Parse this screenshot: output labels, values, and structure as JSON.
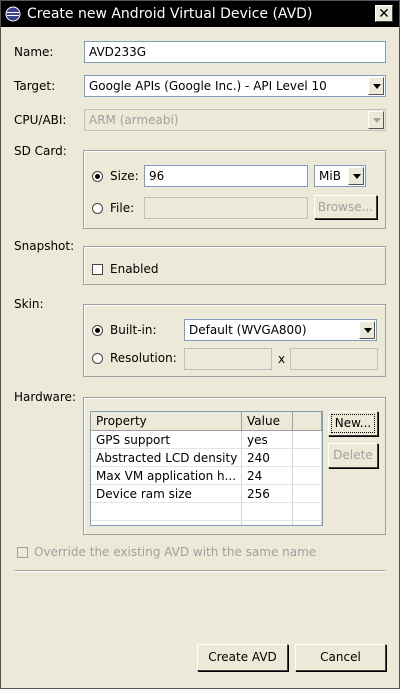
{
  "window": {
    "title": "Create new Android Virtual Device (AVD)",
    "close_glyph": "✕"
  },
  "name": {
    "label": "Name:",
    "value": "AVD233G"
  },
  "target": {
    "label": "Target:",
    "value": "Google APIs (Google Inc.) - API Level 10"
  },
  "cpu": {
    "label": "CPU/ABI:",
    "value": "ARM (armeabi)"
  },
  "sdcard": {
    "label": "SD Card:",
    "size_label": "Size:",
    "size_value": "96",
    "unit": "MiB",
    "file_label": "File:",
    "file_value": "",
    "browse_label": "Browse..."
  },
  "snapshot": {
    "label": "Snapshot:",
    "enabled_label": "Enabled"
  },
  "skin": {
    "label": "Skin:",
    "builtin_label": "Built-in:",
    "builtin_value": "Default (WVGA800)",
    "resolution_label": "Resolution:",
    "x_label": "x"
  },
  "hardware": {
    "label": "Hardware:",
    "columns": [
      "Property",
      "Value"
    ],
    "rows": [
      {
        "property": "GPS support",
        "value": "yes"
      },
      {
        "property": "Abstracted LCD density",
        "value": "240"
      },
      {
        "property": "Max VM application h...",
        "value": "24"
      },
      {
        "property": "Device ram size",
        "value": "256"
      }
    ],
    "new_label": "New...",
    "delete_label": "Delete"
  },
  "override_label": "Override the existing AVD with the same name",
  "buttons": {
    "create_label": "Create AVD",
    "cancel_label": "Cancel"
  },
  "colors": {
    "titlebar": "#000000",
    "dialog_bg": "#ece9d8",
    "disabled_text": "#a0a0a0"
  }
}
